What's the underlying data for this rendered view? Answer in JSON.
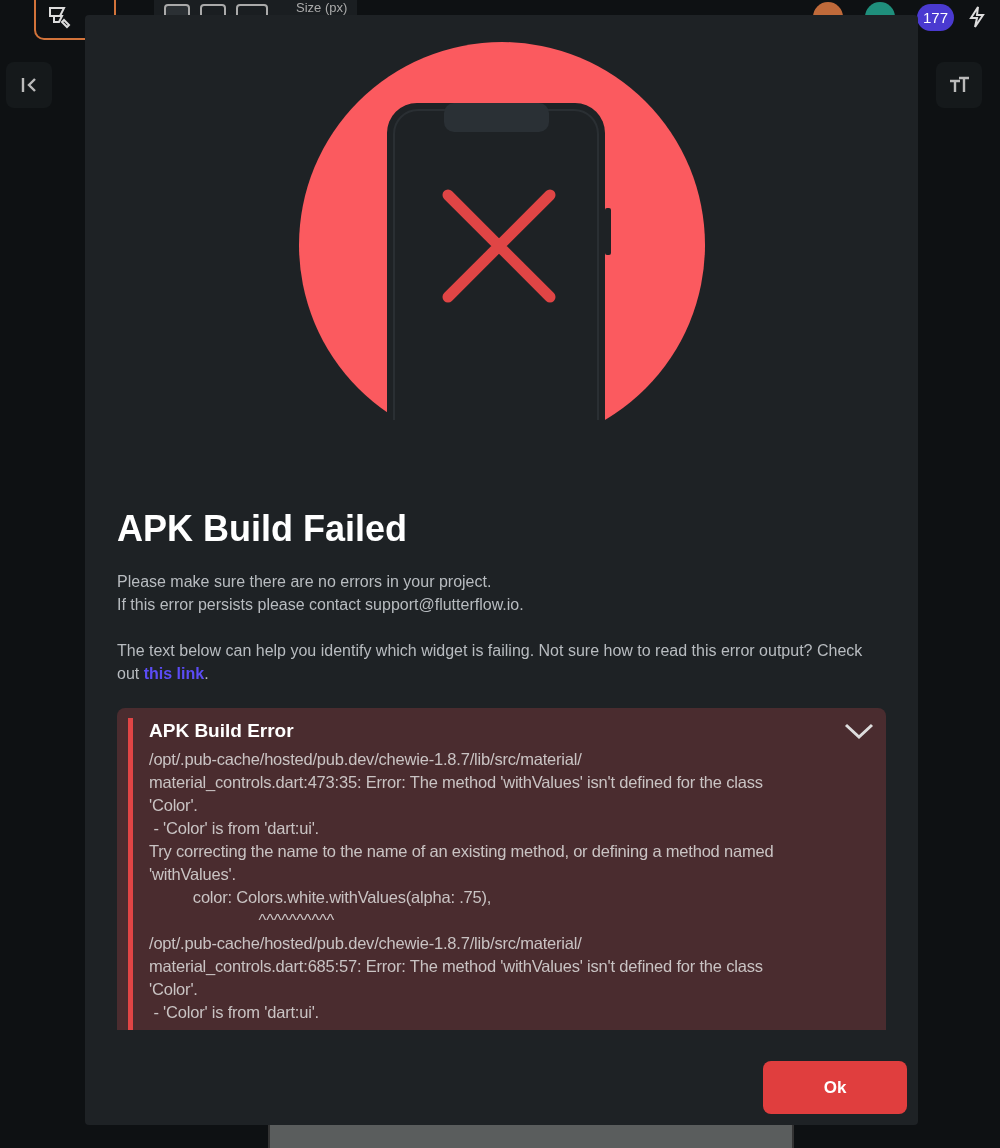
{
  "background_toolbar": {
    "size_label": "Size (px)",
    "badge_count": "177"
  },
  "dialog": {
    "title": "APK Build Failed",
    "message_lines": [
      "Please make sure there are no errors in your project.",
      "If this error persists please contact support@flutterflow.io."
    ],
    "help_text": "The text below can help you identify which widget is failing. Not sure how to read this error output? Check out ",
    "help_link": "this link",
    "help_end": ".",
    "error_panel": {
      "title": "APK Build Error",
      "expanded": true,
      "lines": [
        "/opt/.pub-cache/hosted/pub.dev/chewie-1.8.7/lib/src/material/",
        "material_controls.dart:473:35: Error: The method 'withValues' isn't defined for the class",
        "'Color'.",
        " - 'Color' is from 'dart:ui'.",
        "Try correcting the name to the name of an existing method, or defining a method named",
        "'withValues'.",
        "          color: Colors.white.withValues(alpha: .75),",
        "                         ^^^^^^^^^^",
        "/opt/.pub-cache/hosted/pub.dev/chewie-1.8.7/lib/src/material/",
        "material_controls.dart:685:57: Error: The method 'withValues' isn't defined for the class",
        "'Color'.",
        " - 'Color' is from 'dart:ui'."
      ]
    },
    "ok_button": "Ok"
  }
}
